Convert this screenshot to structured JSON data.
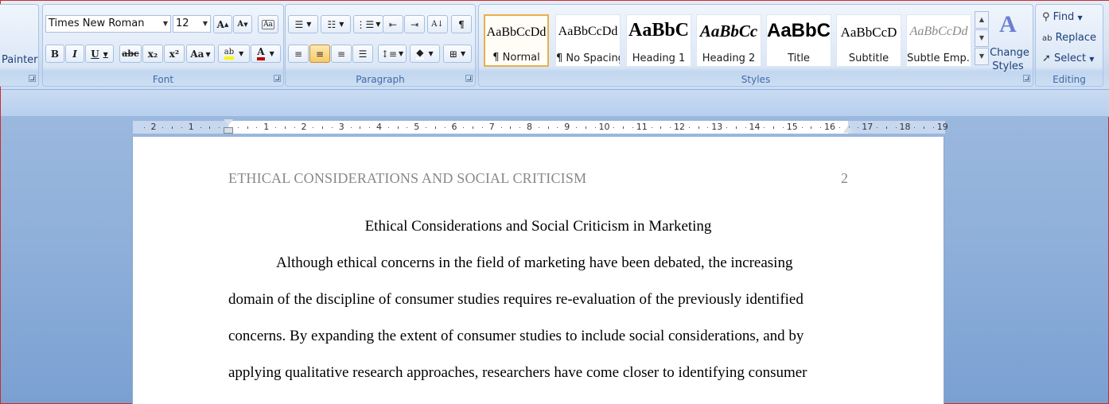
{
  "clipboard": {
    "format_painter_label": "Painter"
  },
  "font": {
    "group_label": "Font",
    "family_value": "Times New Roman",
    "size_value": "12",
    "grow_label": "A",
    "shrink_label": "A",
    "bold_label": "B",
    "italic_label": "I",
    "underline_label": "U",
    "strike_label": "abc",
    "subscript_label": "x₂",
    "superscript_label": "x²",
    "case_label": "Aa",
    "highlight_label": "ab",
    "color_label": "A"
  },
  "paragraph": {
    "group_label": "Paragraph",
    "pilcrow": "¶"
  },
  "styles": {
    "group_label": "Styles",
    "items": [
      {
        "sample": "AaBbCcDd",
        "name": "¶ Normal"
      },
      {
        "sample": "AaBbCcDd",
        "name": "¶ No Spacing"
      },
      {
        "sample": "AaBbC",
        "name": "Heading 1"
      },
      {
        "sample": "AaBbCc",
        "name": "Heading 2"
      },
      {
        "sample": "AaBbC",
        "name": "Title"
      },
      {
        "sample": "AaBbCcD",
        "name": "Subtitle"
      },
      {
        "sample": "AaBbCcDd",
        "name": "Subtle Emp..."
      }
    ],
    "change_styles_label_1": "Change",
    "change_styles_label_2": "Styles"
  },
  "editing": {
    "group_label": "Editing",
    "find_label": "Find",
    "replace_label": "Replace",
    "select_label": "Select"
  },
  "ruler": {
    "numbers": [
      "2",
      "1",
      "1",
      "2",
      "3",
      "4",
      "5",
      "6",
      "7",
      "8",
      "9",
      "10",
      "11",
      "12",
      "13",
      "14",
      "15",
      "16",
      "17",
      "18",
      "19"
    ]
  },
  "document": {
    "header": "ETHICAL CONSIDERATIONS AND SOCIAL CRITICISM",
    "page_number": "2",
    "title": "Ethical Considerations and Social Criticism in Marketing",
    "lines": [
      "Although ethical concerns in the field of marketing have been debated, the increasing",
      "domain of the discipline of consumer studies requires re-evaluation of the previously identified",
      "concerns. By expanding the extent of consumer studies to include social considerations, and by",
      "applying qualitative research approaches, researchers have come  closer to identifying consumer"
    ]
  }
}
